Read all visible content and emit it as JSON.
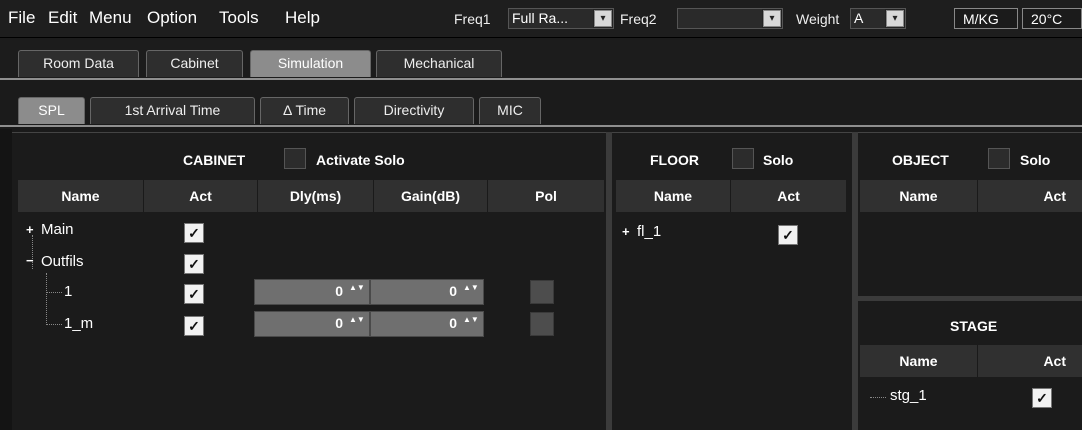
{
  "menu": {
    "file": "File",
    "edit": "Edit",
    "menu": "Menu",
    "option": "Option",
    "tools": "Tools",
    "help": "Help"
  },
  "toolbar": {
    "freq1_label": "Freq1",
    "freq1_value": "Full Ra...",
    "freq2_label": "Freq2",
    "freq2_value": "",
    "weight_label": "Weight",
    "weight_value": "A",
    "unit": "M/KG",
    "temp": "20°C"
  },
  "main_tabs": [
    "Room Data",
    "Cabinet",
    "Simulation",
    "Mechanical"
  ],
  "sub_tabs": [
    "SPL",
    "1st Arrival Time",
    "Δ Time",
    "Directivity",
    "MIC"
  ],
  "cabinet": {
    "title": "CABINET",
    "solo_label": "Activate Solo",
    "columns": [
      "Name",
      "Act",
      "Dly(ms)",
      "Gain(dB)",
      "Pol"
    ],
    "rows": [
      {
        "name": "Main",
        "act": "✓"
      },
      {
        "name": "Outfils",
        "act": "✓"
      },
      {
        "name": "1",
        "act": "✓",
        "dly": "0",
        "gain": "0"
      },
      {
        "name": "1_m",
        "act": "✓",
        "dly": "0",
        "gain": "0"
      }
    ]
  },
  "floor": {
    "title": "FLOOR",
    "solo_label": "Solo",
    "columns": [
      "Name",
      "Act"
    ],
    "rows": [
      {
        "name": "fl_1",
        "act": "✓"
      }
    ]
  },
  "object": {
    "title": "OBJECT",
    "solo_label": "Solo",
    "columns": [
      "Name",
      "Act"
    ]
  },
  "stage": {
    "title": "STAGE",
    "columns": [
      "Name",
      "Act"
    ],
    "rows": [
      {
        "name": "stg_1",
        "act": "✓"
      }
    ]
  },
  "glyphs": {
    "expand": "+",
    "collapse": "−",
    "spin": "▲▼",
    "dropdown": "▾"
  }
}
